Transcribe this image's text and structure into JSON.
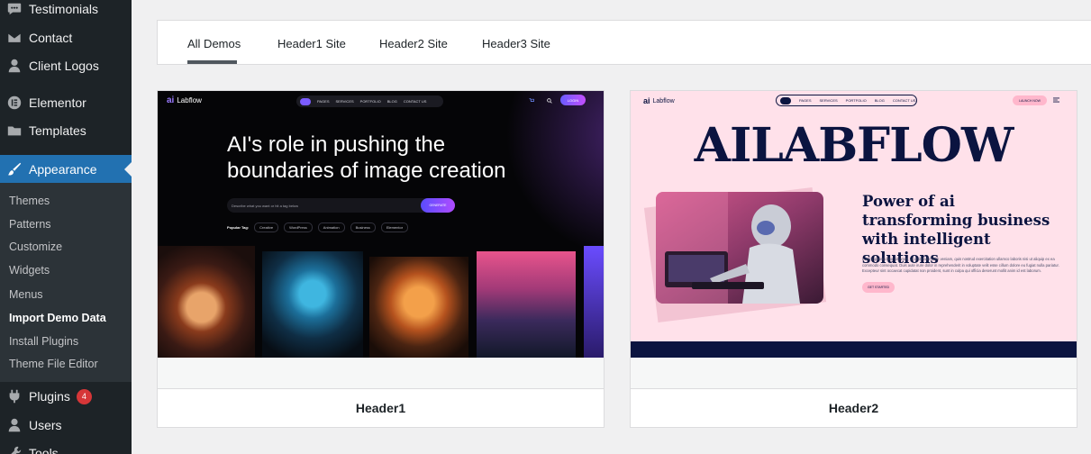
{
  "sidebar": {
    "items": [
      {
        "label": "Testimonials",
        "icon": "testimonials-icon"
      },
      {
        "label": "Contact",
        "icon": "mail-icon"
      },
      {
        "label": "Client Logos",
        "icon": "user-icon"
      },
      {
        "label": "Elementor",
        "icon": "elementor-icon"
      },
      {
        "label": "Templates",
        "icon": "folder-icon"
      },
      {
        "label": "Appearance",
        "icon": "paint-brush-icon",
        "active": true
      },
      {
        "label": "Plugins",
        "icon": "plugin-icon",
        "badge": "4"
      },
      {
        "label": "Users",
        "icon": "user-icon"
      },
      {
        "label": "Tools",
        "icon": "wrench-icon"
      }
    ],
    "submenu": [
      "Themes",
      "Patterns",
      "Customize",
      "Widgets",
      "Menus",
      "Import Demo Data",
      "Install Plugins",
      "Theme File Editor"
    ],
    "submenu_current": "Import Demo Data"
  },
  "tabs": [
    {
      "label": "All Demos",
      "active": true
    },
    {
      "label": "Header1 Site"
    },
    {
      "label": "Header2 Site"
    },
    {
      "label": "Header3 Site"
    }
  ],
  "demos": [
    {
      "title": "Header1",
      "preview": {
        "logo": "Labflow",
        "nav": [
          "PAGES",
          "SERVICES",
          "PORTFOLIO",
          "BLOG",
          "CONTACT US"
        ],
        "login": "LOGIN",
        "headline": "AI's role in pushing the boundaries of image creation",
        "prompt_placeholder": "Describe what you want or hit a tag below",
        "generate": "GENERATE",
        "popular_label": "Popular Tag:",
        "tags": [
          "Creative",
          "WordPress",
          "Animation",
          "Business",
          "Elementor"
        ]
      }
    },
    {
      "title": "Header2",
      "preview": {
        "logo": "Labflow",
        "nav": [
          "PAGES",
          "SERVICES",
          "PORTFOLIO",
          "BLOG",
          "CONTACT US"
        ],
        "launch": "LAUNCH NOW",
        "big_title": "AILABFLOW",
        "tagline": "Power of ai transforming business with intelligent solutions",
        "lorem": "Lorem ipsum dolor sit amet, Ut enim ad minim veniam, quis nostrud exercitation ullamco laboris nisi ut aliquip ex ea commodo consequat. Duis aute irure dolor in reprehenderit in voluptate velit esse cillum dolore eu fugiat nulla pariatur. Excepteur sint occaecat cupidatat non proident, sunt in culpa qui officia deserunt mollit anim id est laborum.",
        "cta": "GET STARTED"
      }
    }
  ],
  "colors": {
    "sidebar_bg": "#1d2327",
    "accent": "#2271b1",
    "badge": "#d63638"
  }
}
